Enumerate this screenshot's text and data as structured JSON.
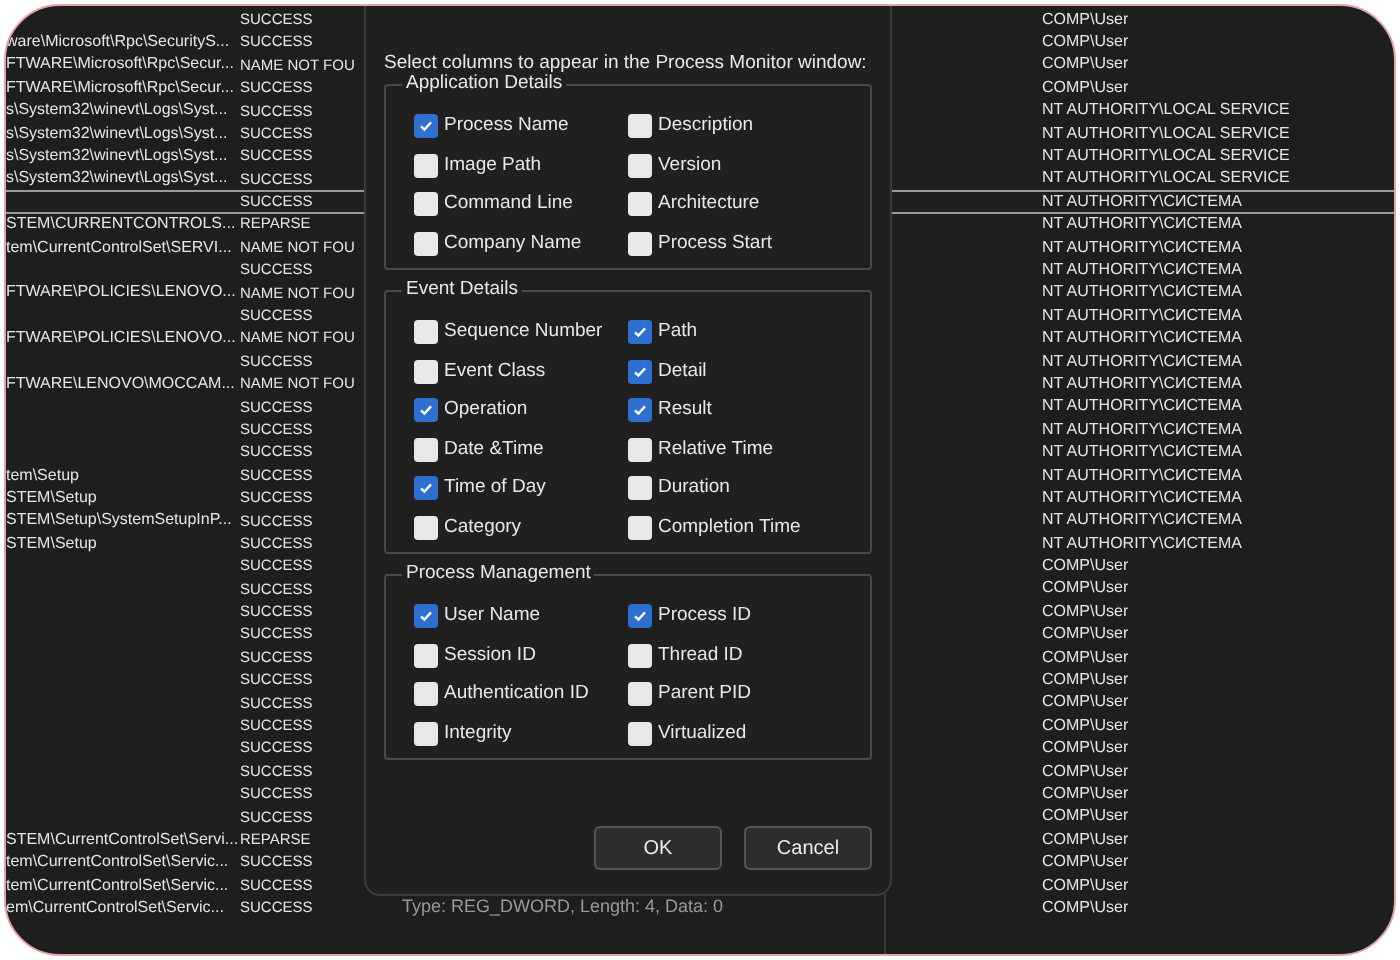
{
  "table": {
    "rows": [
      {
        "path": "",
        "result": "SUCCESS",
        "detail": "",
        "user": "COMP\\User",
        "selected": false
      },
      {
        "path": "ware\\Microsoft\\Rpc\\SecurityS...",
        "result": "SUCCESS",
        "detail": "",
        "user": "COMP\\User",
        "selected": false
      },
      {
        "path": "FTWARE\\Microsoft\\Rpc\\Secur...",
        "result": "NAME NOT FOU",
        "detail": "",
        "user": "COMP\\User",
        "selected": false
      },
      {
        "path": "FTWARE\\Microsoft\\Rpc\\Secur...",
        "result": "SUCCESS",
        "detail": "",
        "user": "COMP\\User",
        "selected": false
      },
      {
        "path": "s\\System32\\winevt\\Logs\\Syst...",
        "result": "SUCCESS",
        "detail": "",
        "user": "NT AUTHORITY\\LOCAL SERVICE",
        "selected": false
      },
      {
        "path": "s\\System32\\winevt\\Logs\\Syst...",
        "result": "SUCCESS",
        "detail": "",
        "user": "NT AUTHORITY\\LOCAL SERVICE",
        "selected": false
      },
      {
        "path": "s\\System32\\winevt\\Logs\\Syst...",
        "result": "SUCCESS",
        "detail": "",
        "user": "NT AUTHORITY\\LOCAL SERVICE",
        "selected": false
      },
      {
        "path": "s\\System32\\winevt\\Logs\\Syst...",
        "result": "SUCCESS",
        "detail": "",
        "user": "NT AUTHORITY\\LOCAL SERVICE",
        "selected": false
      },
      {
        "path": "",
        "result": "SUCCESS",
        "detail": "",
        "user": "NT AUTHORITY\\СИСТЕМА",
        "selected": true
      },
      {
        "path": "STEM\\CURRENTCONTROLS...",
        "result": "REPARSE",
        "detail": "",
        "user": "NT AUTHORITY\\СИСТЕМА",
        "selected": false
      },
      {
        "path": "tem\\CurrentControlSet\\SERVI...",
        "result": "NAME NOT FOU",
        "detail": "",
        "user": "NT AUTHORITY\\СИСТЕМА",
        "selected": false
      },
      {
        "path": "",
        "result": "SUCCESS",
        "detail": "",
        "user": "NT AUTHORITY\\СИСТЕМА",
        "selected": false
      },
      {
        "path": "FTWARE\\POLICIES\\LENOVO...",
        "result": "NAME NOT FOU",
        "detail": "",
        "user": "NT AUTHORITY\\СИСТЕМА",
        "selected": false
      },
      {
        "path": "",
        "result": "SUCCESS",
        "detail": "",
        "user": "NT AUTHORITY\\СИСТЕМА",
        "selected": false
      },
      {
        "path": "FTWARE\\POLICIES\\LENOVO...",
        "result": "NAME NOT FOU",
        "detail": "",
        "user": "NT AUTHORITY\\СИСТЕМА",
        "selected": false
      },
      {
        "path": "",
        "result": "SUCCESS",
        "detail": "",
        "user": "NT AUTHORITY\\СИСТЕМА",
        "selected": false
      },
      {
        "path": "FTWARE\\LENOVO\\MOCCAM...",
        "result": "NAME NOT FOU",
        "detail": "",
        "user": "NT AUTHORITY\\СИСТЕМА",
        "selected": false
      },
      {
        "path": "",
        "result": "SUCCESS",
        "detail": "",
        "user": "NT AUTHORITY\\СИСТЕМА",
        "selected": false
      },
      {
        "path": "",
        "result": "SUCCESS",
        "detail": "",
        "user": "NT AUTHORITY\\СИСТЕМА",
        "selected": false
      },
      {
        "path": "",
        "result": "SUCCESS",
        "detail": "",
        "user": "NT AUTHORITY\\СИСТЕМА",
        "selected": false
      },
      {
        "path": "tem\\Setup",
        "result": "SUCCESS",
        "detail": "",
        "user": "NT AUTHORITY\\СИСТЕМА",
        "selected": false
      },
      {
        "path": "STEM\\Setup",
        "result": "SUCCESS",
        "detail": "",
        "user": "NT AUTHORITY\\СИСТЕМА",
        "selected": false
      },
      {
        "path": "STEM\\Setup\\SystemSetupInP...",
        "result": "SUCCESS",
        "detail": "",
        "user": "NT AUTHORITY\\СИСТЕМА",
        "selected": false
      },
      {
        "path": "STEM\\Setup",
        "result": "SUCCESS",
        "detail": "",
        "user": "NT AUTHORITY\\СИСТЕМА",
        "selected": false
      },
      {
        "path": "",
        "result": "SUCCESS",
        "detail": "",
        "user": "COMP\\User",
        "selected": false
      },
      {
        "path": "",
        "result": "SUCCESS",
        "detail": "",
        "user": "COMP\\User",
        "selected": false
      },
      {
        "path": "",
        "result": "SUCCESS",
        "detail": "",
        "user": "COMP\\User",
        "selected": false
      },
      {
        "path": "",
        "result": "SUCCESS",
        "detail": "",
        "user": "COMP\\User",
        "selected": false
      },
      {
        "path": "",
        "result": "SUCCESS",
        "detail": "",
        "user": "COMP\\User",
        "selected": false
      },
      {
        "path": "",
        "result": "SUCCESS",
        "detail": "",
        "user": "COMP\\User",
        "selected": false
      },
      {
        "path": "",
        "result": "SUCCESS",
        "detail": "",
        "user": "COMP\\User",
        "selected": false
      },
      {
        "path": "",
        "result": "SUCCESS",
        "detail": "",
        "user": "COMP\\User",
        "selected": false
      },
      {
        "path": "",
        "result": "SUCCESS",
        "detail": "",
        "user": "COMP\\User",
        "selected": false
      },
      {
        "path": "",
        "result": "SUCCESS",
        "detail": "",
        "user": "COMP\\User",
        "selected": false
      },
      {
        "path": "",
        "result": "SUCCESS",
        "detail": "",
        "user": "COMP\\User",
        "selected": false
      },
      {
        "path": "",
        "result": "SUCCESS",
        "detail": "",
        "user": "COMP\\User",
        "selected": false
      },
      {
        "path": "STEM\\CurrentControlSet\\Servi...",
        "result": "REPARSE",
        "detail": "",
        "user": "COMP\\User",
        "selected": false
      },
      {
        "path": "tem\\CurrentControlSet\\Servic...",
        "result": "SUCCESS",
        "detail": "",
        "user": "COMP\\User",
        "selected": false
      },
      {
        "path": "tem\\CurrentControlSet\\Servic...",
        "result": "SUCCESS",
        "detail": "",
        "user": "COMP\\User",
        "selected": false
      },
      {
        "path": "em\\CurrentControlSet\\Servic...",
        "result": "SUCCESS",
        "detail": "Type: REG_DWORD, Length: 4, Data: 0",
        "user": "COMP\\User",
        "selected": false
      }
    ]
  },
  "dialog": {
    "prompt": "Select columns to appear in the Process Monitor window:",
    "groups": [
      {
        "title": "Application Details",
        "options": [
          {
            "label": "Process Name",
            "checked": true
          },
          {
            "label": "Description",
            "checked": false
          },
          {
            "label": "Image Path",
            "checked": false
          },
          {
            "label": "Version",
            "checked": false
          },
          {
            "label": "Command Line",
            "checked": false
          },
          {
            "label": "Architecture",
            "checked": false
          },
          {
            "label": "Company Name",
            "checked": false
          },
          {
            "label": "Process Start",
            "checked": false
          }
        ]
      },
      {
        "title": "Event Details",
        "options": [
          {
            "label": "Sequence Number",
            "checked": false
          },
          {
            "label": "Path",
            "checked": true
          },
          {
            "label": "Event Class",
            "checked": false
          },
          {
            "label": "Detail",
            "checked": true
          },
          {
            "label": "Operation",
            "checked": true
          },
          {
            "label": "Result",
            "checked": true
          },
          {
            "label": "Date &Time",
            "checked": false
          },
          {
            "label": "Relative Time",
            "checked": false
          },
          {
            "label": "Time of Day",
            "checked": true
          },
          {
            "label": "Duration",
            "checked": false
          },
          {
            "label": "Category",
            "checked": false
          },
          {
            "label": "Completion Time",
            "checked": false
          }
        ]
      },
      {
        "title": "Process Management",
        "options": [
          {
            "label": "User Name",
            "checked": true
          },
          {
            "label": "Process ID",
            "checked": true
          },
          {
            "label": "Session ID",
            "checked": false
          },
          {
            "label": "Thread ID",
            "checked": false
          },
          {
            "label": "Authentication ID",
            "checked": false
          },
          {
            "label": "Parent PID",
            "checked": false
          },
          {
            "label": "Integrity",
            "checked": false
          },
          {
            "label": "Virtualized",
            "checked": false
          }
        ]
      }
    ],
    "buttons": [
      {
        "label": "OK"
      },
      {
        "label": "Cancel"
      }
    ]
  }
}
